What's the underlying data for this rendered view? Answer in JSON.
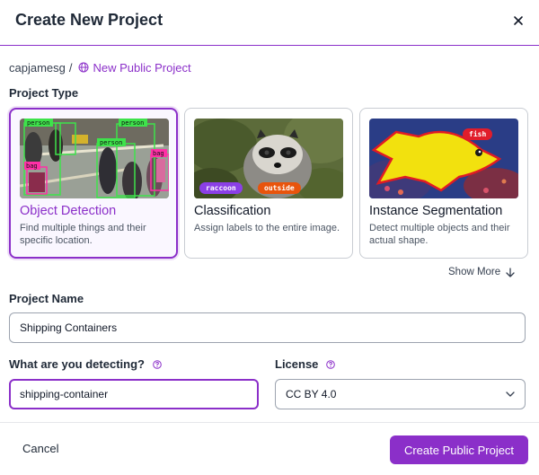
{
  "dialog": {
    "title": "Create New Project",
    "close_icon": "close-icon"
  },
  "breadcrumb": {
    "user": "capjamesg",
    "separator": "/",
    "project": "New Public Project",
    "project_icon": "globe-icon"
  },
  "project_type": {
    "label": "Project Type",
    "cards": [
      {
        "title": "Object Detection",
        "description": "Find multiple things and their specific location.",
        "selected": true,
        "image_labels": [
          "person",
          "person",
          "person",
          "bag",
          "bag"
        ]
      },
      {
        "title": "Classification",
        "description": "Assign labels to the entire image.",
        "selected": false,
        "image_labels": [
          "raccoon",
          "outside"
        ]
      },
      {
        "title": "Instance Segmentation",
        "description": "Detect multiple objects and their actual shape.",
        "selected": false,
        "image_labels": [
          "fish"
        ]
      }
    ],
    "show_more": "Show More"
  },
  "project_name": {
    "label": "Project Name",
    "value": "Shipping Containers"
  },
  "detecting": {
    "label": "What are you detecting?",
    "value": "shipping-container"
  },
  "license": {
    "label": "License",
    "value": "CC BY 4.0"
  },
  "footer": {
    "cancel": "Cancel",
    "create": "Create Public Project"
  },
  "colors": {
    "accent": "#8b2fc9",
    "tag_purple": "#8b3fe6",
    "tag_orange": "#e8540c",
    "tag_red": "#e11d2b"
  }
}
